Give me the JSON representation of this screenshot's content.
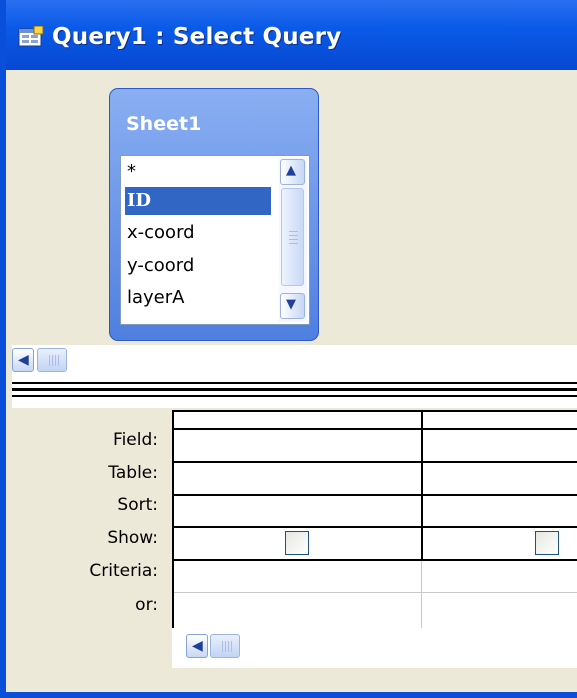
{
  "window": {
    "title": "Query1 : Select Query",
    "icon": "query-window-icon"
  },
  "table_box": {
    "title": "Sheet1",
    "fields": [
      "*",
      "ID",
      "x-coord",
      "y-coord",
      "layerA"
    ],
    "selected_field": "ID"
  },
  "grid": {
    "row_labels": [
      "Field:",
      "Table:",
      "Sort:",
      "Show:",
      "Criteria:",
      "or:"
    ],
    "columns": 2,
    "show_checked": [
      false,
      false
    ]
  },
  "colors": {
    "title_bar": "#0a5ae8",
    "selection": "#3166c5",
    "table_header": "#6f97ea"
  }
}
